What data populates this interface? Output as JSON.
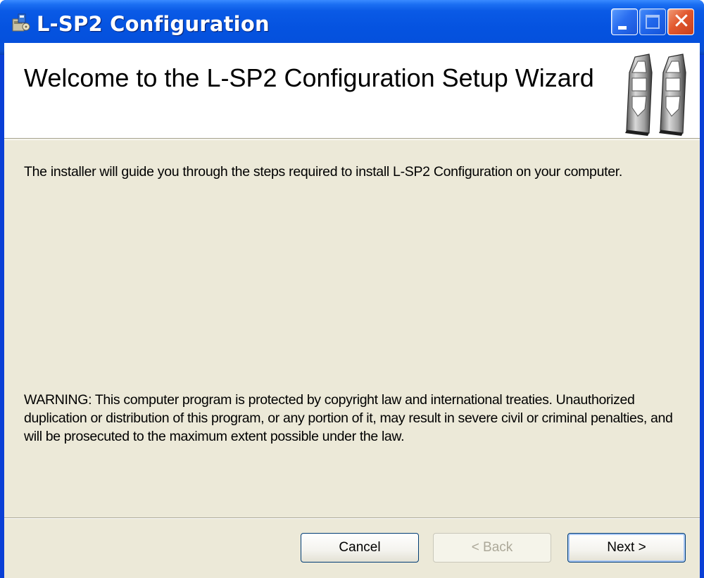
{
  "window": {
    "title": "L-SP2 Configuration",
    "icon": "installer-icon",
    "controls": {
      "minimize": "minimize-icon",
      "maximize": "maximize-icon",
      "close": "close-icon"
    }
  },
  "banner": {
    "title": "Welcome to the L-SP2 Configuration Setup Wizard",
    "graphic": "security-gates-icon"
  },
  "body": {
    "intro": "The installer will guide you through the steps required to install L-SP2 Configuration on your computer.",
    "warning": "WARNING: This computer program is protected by copyright law and international treaties. Unauthorized duplication or distribution of this program, or any portion of it, may result in severe civil or criminal penalties, and will be prosecuted to the maximum extent possible under the law."
  },
  "buttons": {
    "cancel": "Cancel",
    "back": "< Back",
    "next": "Next >"
  },
  "colors": {
    "titlebar": "#0553e0",
    "dialog_face": "#ece9d8",
    "close_button": "#e2582e",
    "disabled_text": "#aca899"
  }
}
